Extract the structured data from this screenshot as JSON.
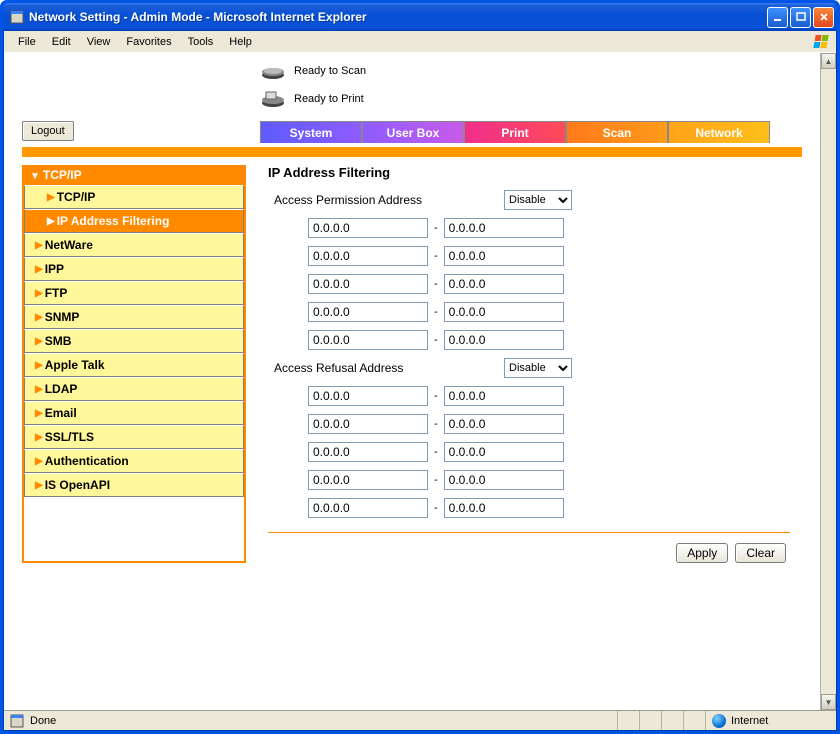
{
  "window": {
    "title": "Network Setting - Admin Mode - Microsoft Internet Explorer"
  },
  "menubar": {
    "file": "File",
    "edit": "Edit",
    "view": "View",
    "favorites": "Favorites",
    "tools": "Tools",
    "help": "Help"
  },
  "status": {
    "scan": "Ready to Scan",
    "print": "Ready to Print"
  },
  "logout_label": "Logout",
  "tabs": {
    "system": "System",
    "userbox": "User Box",
    "print": "Print",
    "scan": "Scan",
    "network": "Network"
  },
  "sidebar": {
    "header": "TCP/IP",
    "items": [
      "TCP/IP",
      "IP Address Filtering",
      "NetWare",
      "IPP",
      "FTP",
      "SNMP",
      "SMB",
      "Apple Talk",
      "LDAP",
      "Email",
      "SSL/TLS",
      "Authentication",
      "IS OpenAPI"
    ]
  },
  "main": {
    "heading": "IP Address Filtering",
    "permission_label": "Access Permission Address",
    "refusal_label": "Access Refusal Address",
    "disable_option": "Disable",
    "default_ip": "0.0.0.0",
    "apply_label": "Apply",
    "clear_label": "Clear"
  },
  "statusbar": {
    "done": "Done",
    "zone": "Internet"
  }
}
